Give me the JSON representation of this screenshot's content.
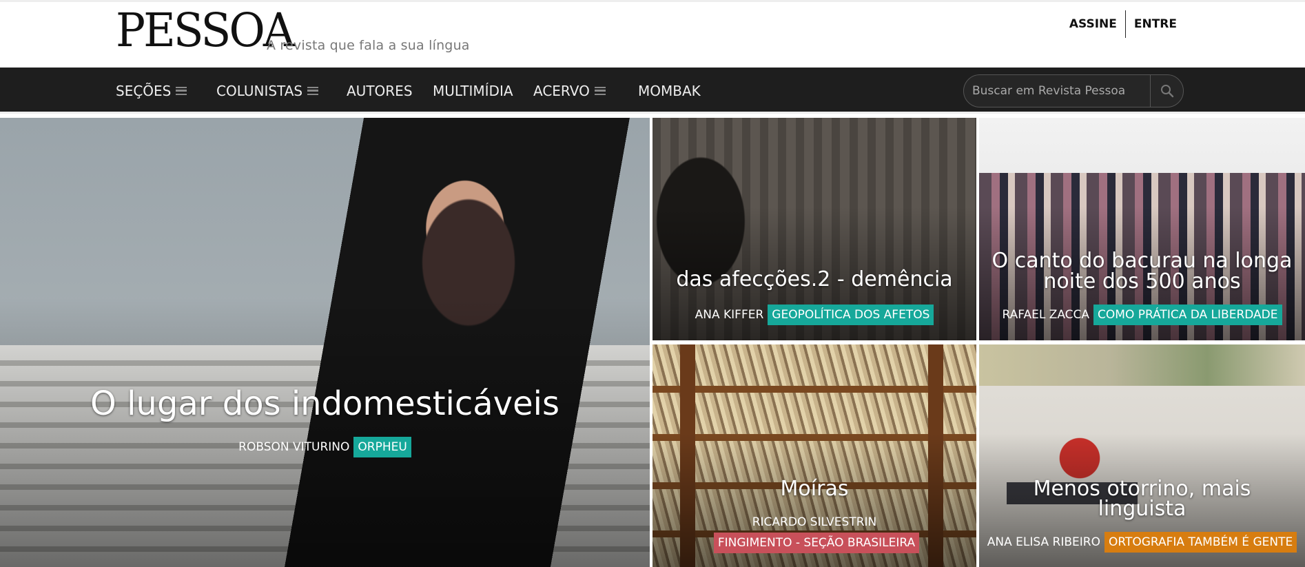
{
  "header": {
    "logo_text": "PESSOA",
    "tagline": "A revista que fala a sua língua",
    "subscribe_label": "ASSINE",
    "login_label": "ENTRE"
  },
  "nav": {
    "items": [
      {
        "label": "SEÇÕES",
        "menu": true
      },
      {
        "label": "COLUNISTAS",
        "menu": true
      },
      {
        "label": "AUTORES",
        "menu": false
      },
      {
        "label": "MULTIMÍDIA",
        "menu": false
      },
      {
        "label": "ACERVO",
        "menu": true
      },
      {
        "label": "MOMBAK",
        "menu": false
      }
    ],
    "search_placeholder": "Buscar em Revista Pessoa"
  },
  "articles": [
    {
      "title": "O lugar dos indomesticáveis",
      "author": "ROBSON VITURINO",
      "tag": "ORPHEU",
      "tag_color": "#16a89a"
    },
    {
      "title": "das afecções.2 - demência",
      "author": "ANA KIFFER",
      "tag": "GEOPOLÍTICA DOS AFETOS",
      "tag_color": "#16a89a"
    },
    {
      "title": "O canto do bacurau na longa noite dos 500 anos",
      "author": "RAFAEL ZACCA",
      "tag": "COMO PRÁTICA DA LIBERDADE",
      "tag_color": "#16a89a"
    },
    {
      "title": "Moíras",
      "author": "RICARDO SILVESTRIN",
      "tag": "FINGIMENTO - SEÇÃO BRASILEIRA",
      "tag_color": "#c8505a"
    },
    {
      "title": "Menos otorrino, mais linguista",
      "author": "ANA ELISA RIBEIRO",
      "tag": "ORTOGRAFIA TAMBÉM É GENTE",
      "tag_color": "#d77d10"
    }
  ],
  "icons": [
    "menu-icon",
    "search-icon"
  ]
}
